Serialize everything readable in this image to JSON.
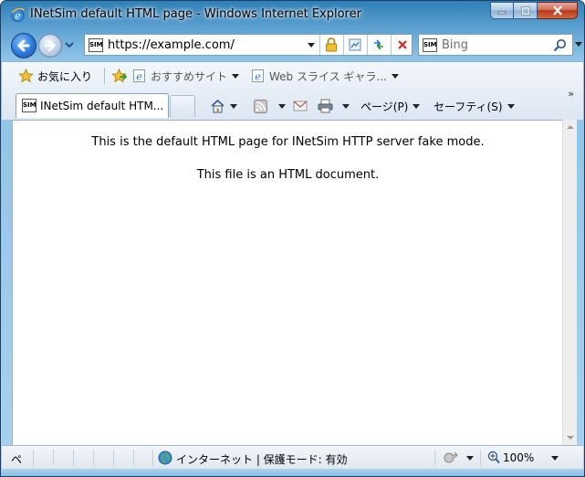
{
  "window": {
    "title": "INetSim default HTML page - Windows Internet Explorer"
  },
  "address_bar": {
    "favicon_text": "SIM",
    "url": "https://example.com/"
  },
  "search": {
    "favicon_text": "SIM",
    "placeholder": "Bing"
  },
  "favorites_bar": {
    "favorites_label": "お気に入り",
    "suggested_sites_label": "おすすめサイト",
    "web_slice_label": "Web スライス ギャラ..."
  },
  "tabs": {
    "active_tab_label": "INetSim default HTM...",
    "favicon_text": "SIM"
  },
  "command_bar": {
    "page_label": "ページ(P)",
    "safety_label": "セーフティ(S)"
  },
  "content": {
    "line1": "This is the default HTML page for INetSim HTTP server fake mode.",
    "line2": "This file is an HTML document."
  },
  "status_bar": {
    "left_text": "ペ",
    "zone_text": "インターネット | 保護モード: 有効",
    "zoom_text": "100%"
  },
  "colors": {
    "frame": "#a9d2ee",
    "accent": "#2b78d8",
    "close": "#b8391b"
  }
}
